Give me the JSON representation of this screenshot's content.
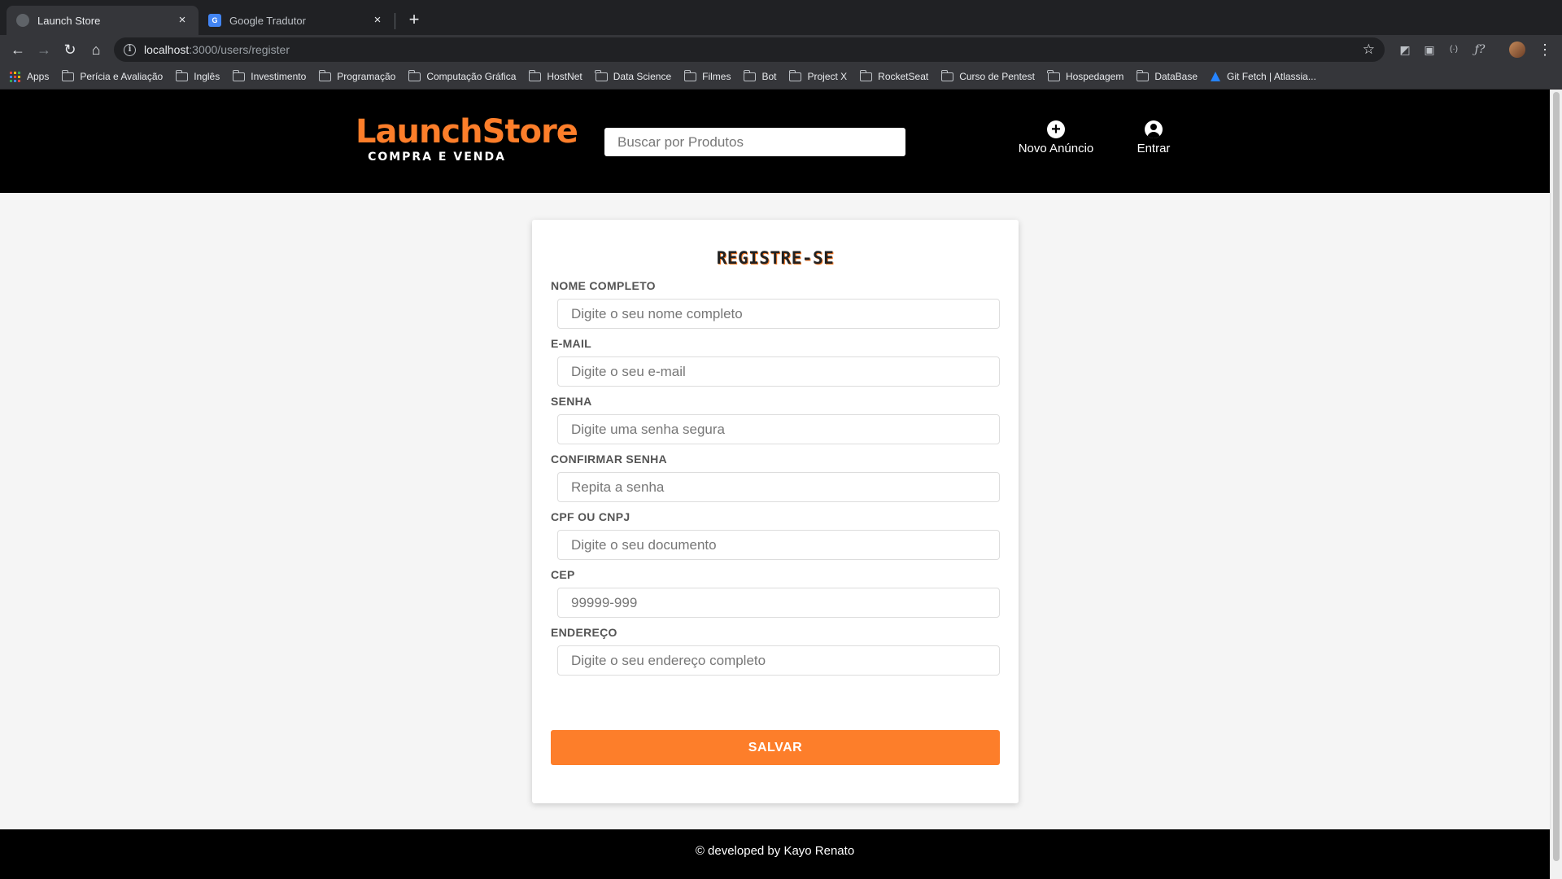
{
  "browser": {
    "tabs": [
      {
        "title": "Launch Store",
        "active": true
      },
      {
        "title": "Google Tradutor",
        "active": false,
        "favicon_text": "G"
      }
    ],
    "url_host": "localhost",
    "url_path": ":3000/users/register",
    "bookmarks": [
      {
        "label": "Apps",
        "icon": "apps-grid-icon"
      },
      {
        "label": "Perícia e Avaliação",
        "icon": "folder-icon"
      },
      {
        "label": "Inglês",
        "icon": "folder-icon"
      },
      {
        "label": "Investimento",
        "icon": "folder-icon"
      },
      {
        "label": "Programação",
        "icon": "folder-icon"
      },
      {
        "label": "Computação Gráfica",
        "icon": "folder-icon"
      },
      {
        "label": "HostNet",
        "icon": "folder-icon"
      },
      {
        "label": "Data Science",
        "icon": "folder-icon"
      },
      {
        "label": "Filmes",
        "icon": "folder-icon"
      },
      {
        "label": "Bot",
        "icon": "folder-icon"
      },
      {
        "label": "Project X",
        "icon": "folder-icon"
      },
      {
        "label": "RocketSeat",
        "icon": "folder-icon"
      },
      {
        "label": "Curso de Pentest",
        "icon": "folder-icon"
      },
      {
        "label": "Hospedagem",
        "icon": "folder-icon"
      },
      {
        "label": "DataBase",
        "icon": "folder-icon"
      },
      {
        "label": "Git Fetch | Atlassia...",
        "icon": "atlassian-icon"
      }
    ]
  },
  "header": {
    "brand": "LaunchStore",
    "tagline": "COMPRA E VENDA",
    "search_placeholder": "Buscar por Produtos",
    "new_ad_label": "Novo Anúncio",
    "login_label": "Entrar"
  },
  "form": {
    "title": "REGISTRE-SE",
    "fields": [
      {
        "label": "NOME COMPLETO",
        "placeholder": "Digite o seu nome completo"
      },
      {
        "label": "E-MAIL",
        "placeholder": "Digite o seu e-mail"
      },
      {
        "label": "SENHA",
        "placeholder": "Digite uma senha segura"
      },
      {
        "label": "CONFIRMAR SENHA",
        "placeholder": "Repita a senha"
      },
      {
        "label": "CPF OU CNPJ",
        "placeholder": "Digite o seu documento"
      },
      {
        "label": "CEP",
        "placeholder": "99999-999"
      },
      {
        "label": "ENDEREÇO",
        "placeholder": "Digite o seu endereço completo"
      }
    ],
    "submit_label": "SALVAR"
  },
  "footer": {
    "text": "© developed by Kayo Renato"
  },
  "colors": {
    "accent": "#fd7e2a",
    "header_bg": "#000000",
    "page_bg": "#f5f5f5"
  }
}
